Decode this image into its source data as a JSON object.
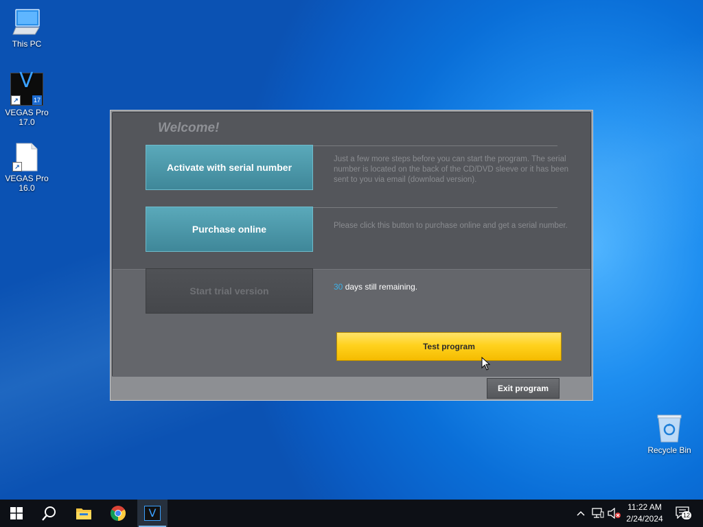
{
  "desktop": {
    "icons": [
      {
        "label": "This PC"
      },
      {
        "label": "VEGAS Pro 17.0",
        "glyph": "V",
        "badge": "17"
      },
      {
        "label": "VEGAS Pro 16.0"
      },
      {
        "label": "Recycle Bin"
      }
    ]
  },
  "dialog": {
    "welcome": "Welcome!",
    "activate": {
      "label": "Activate with serial number",
      "description": "Just a few more steps before you can start the program. The serial number is located on the back of the CD/DVD sleeve or it has been sent to you via email (download version)."
    },
    "purchase": {
      "label": "Purchase online",
      "description": "Please click this button to purchase online and get a serial number."
    },
    "trial": {
      "label": "Start trial version",
      "days": "30",
      "remaining_text": "days still remaining."
    },
    "test_button": "Test program",
    "exit_button": "Exit program"
  },
  "taskbar": {
    "apps": [
      "start-icon",
      "search-icon",
      "file-explorer-icon",
      "chrome-icon",
      "vegas-icon"
    ],
    "vegas_glyph": "V",
    "time": "11:22 AM",
    "date": "2/24/2024",
    "notification_count": "12"
  },
  "colors": {
    "accent_teal": "#4a97a9",
    "button_yellow": "#ffd21e",
    "days_highlight": "#3bb0e8"
  }
}
